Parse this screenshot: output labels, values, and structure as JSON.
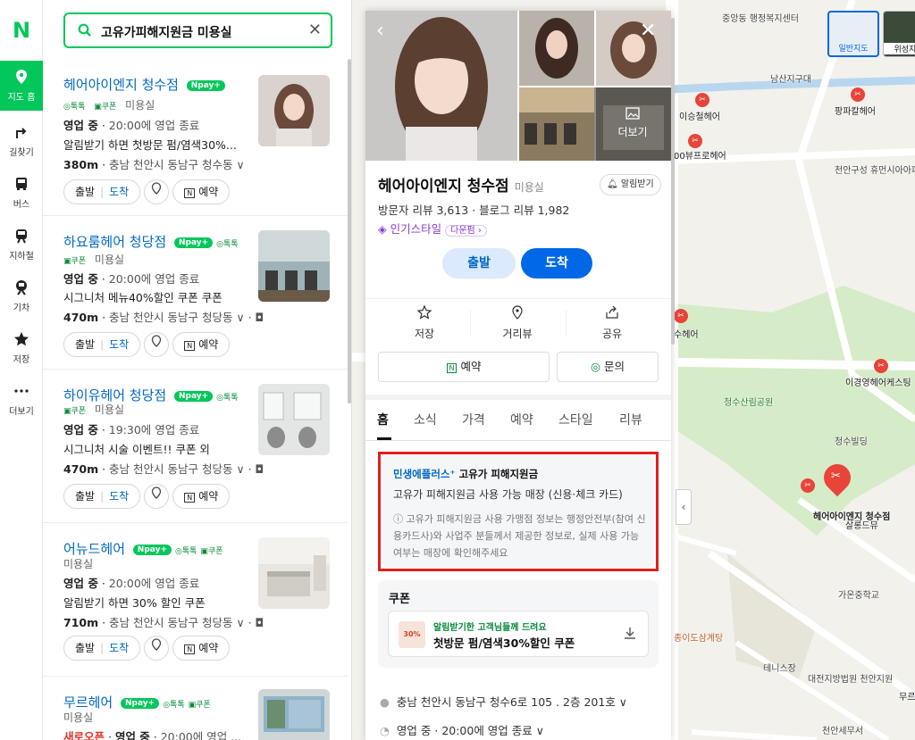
{
  "rail": {
    "logo": "N",
    "items": [
      {
        "label": "지도 홈",
        "icon": "map-pin-icon",
        "active": true
      },
      {
        "label": "길찾기",
        "icon": "directions-icon"
      },
      {
        "label": "버스",
        "icon": "bus-icon"
      },
      {
        "label": "지하철",
        "icon": "subway-icon"
      },
      {
        "label": "기차",
        "icon": "train-icon"
      },
      {
        "label": "저장",
        "icon": "star-icon"
      },
      {
        "label": "더보기",
        "icon": "more-icon"
      }
    ]
  },
  "search": {
    "query": "고유가피해지원금 미용실"
  },
  "results": [
    {
      "name": "헤어아이엔지 청수점",
      "npay": "pay",
      "talk": "톡톡",
      "coupon": "쿠폰",
      "category": "미용실",
      "status": "영업 중",
      "status_detail": "20:00에 영업 종료",
      "promo": "알림받기 하면 첫방문 펌/염색30%...",
      "distance": "380m",
      "address": "충남 천안시 동남구 청수동"
    },
    {
      "name": "하요룸헤어 청당점",
      "npay": "pay",
      "talk": "톡톡",
      "coupon": "쿠폰",
      "category": "미용실",
      "status": "영업 중",
      "status_detail": "20:00에 영업 종료",
      "promo": "시그니처 메뉴40%할인 쿠폰 쿠폰",
      "distance": "470m",
      "address": "충남 천안시 동남구 청당동"
    },
    {
      "name": "하이유헤어 청당점",
      "npay": "pay",
      "talk": "톡톡",
      "coupon": "쿠폰",
      "category": "미용실",
      "status": "영업 중",
      "status_detail": "19:30에 영업 종료",
      "promo": "시그니처 시술 이벤트!! 쿠폰 외",
      "distance": "470m",
      "address": "충남 천안시 동남구 청당동"
    },
    {
      "name": "어뉴드헤어",
      "npay": "pay",
      "talk": "톡톡",
      "coupon": "쿠폰",
      "category": "미용실",
      "status": "영업 중",
      "status_detail": "20:00에 영업 종료",
      "promo": "알림받기 하면 30% 할인 쿠폰",
      "distance": "710m",
      "address": "충남 천안시 동남구 청당동"
    },
    {
      "name": "무르헤어",
      "npay": "pay",
      "talk": "톡톡",
      "coupon": "쿠폰",
      "category": "미용실",
      "new": "새로오픈",
      "status": "영업 중",
      "status_detail": "20:00에 영업 ..."
    }
  ],
  "result_buttons": {
    "depart": "출발",
    "arrive": "도착",
    "reserve": "예약"
  },
  "detail": {
    "name": "헤어아이엔지 청수점",
    "category": "미용실",
    "alarm": "알림받기",
    "reviews": "방문자 리뷰 3,613 · 블로그 리뷰 1,982",
    "style": "인기스타일",
    "style_chip": "다운펌 ›",
    "more_photos": "더보기",
    "depart": "출발",
    "arrive": "도착",
    "actions": [
      "저장",
      "거리뷰",
      "공유"
    ],
    "reserve": "예약",
    "inquiry": "문의",
    "tabs": [
      "홈",
      "소식",
      "가격",
      "예약",
      "스타일",
      "리뷰"
    ],
    "notice": {
      "brand": "민생에플러스",
      "title": "고유가 피해지원금",
      "main": "고유가 피해지원금 사용 가능 매장 (신용·체크 카드)",
      "desc": "ⓘ 고유가 피해지원금 사용 가맹점 정보는 행정안전부(참여 신용카드사)와 사업주 분들께서 제공한 정보로, 실제 사용 가능 여부는 매장에 확인해주세요"
    },
    "coupon": {
      "heading": "쿠폰",
      "badge": "30%",
      "sub": "알림받기한 고객님들께 드려요",
      "title": "첫방문 펌/염색30%할인 쿠폰"
    },
    "address": "충남 천안시 동남구 청수6로 105 . 2층 201호 ∨",
    "hours": "영업 중 · 20:00에 영업 종료 ∨"
  },
  "map": {
    "types": [
      "일반지도",
      "위성지도"
    ],
    "labels": [
      "중앙동 행정복지센터",
      "남산지구대",
      "이승철헤어",
      "00뷰프로헤어",
      "팡파칼헤어",
      "천안구성 휴먼시아아파트",
      "수헤어",
      "이경영헤어케스팅",
      "청수산림공원",
      "청수빌딩",
      "헤어아이엔지 청수점",
      "살롱드뮤",
      "가온중학교",
      "종이도삼계탕",
      "테니스장",
      "대전지방법원 천안지원",
      "천안세무서",
      "무르"
    ],
    "colors": {
      "accent": "#03c75a",
      "link": "#0068c3",
      "highlight": "#e11f1f"
    }
  }
}
